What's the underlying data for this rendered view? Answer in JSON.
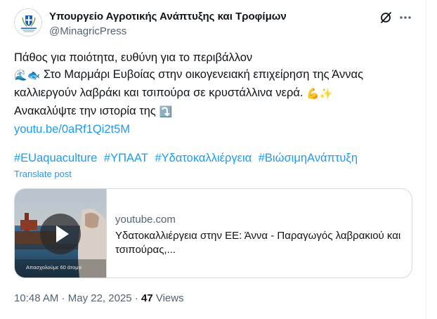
{
  "author": {
    "name": "Υπουργείο Αγροτικής Ανάπτυξης και Τροφίμων",
    "handle": "@MinagricPress",
    "avatar_icon": "greek-coat-of-arms-icon"
  },
  "header_actions": {
    "grok_icon": "grok-icon",
    "more_icon": "more-horizontal-icon"
  },
  "tweet": {
    "line1": "Πάθος για ποιότητα, ευθύνη για το περιβάλλον",
    "line2_emoji": "🌊🐟",
    "line2_text": " Στο Μαρμάρι Ευβοίας στην οικογενειακή επιχείρηση της Άννας",
    "line3_text": "καλλιεργούν λαβράκι και τσιπούρα σε κρυστάλλινα νερά. ",
    "line3_emoji": "💪✨",
    "line4_text": "Ανακαλύψτε την ιστορία της ",
    "line4_emoji": "⤵️",
    "link": "youtu.be/0aRf1Qi2t5M",
    "hashtags": [
      "#EUaquaculture",
      "#ΥΠΑΑΤ",
      "#Υδατοκαλλιέργεια",
      "#ΒιώσιμηΑνάπτυξη"
    ],
    "translate_label": "Translate post"
  },
  "link_card": {
    "domain": "youtube.com",
    "title": "Υδατοκαλλιέργεια στην ΕΕ: Άννα - Παραγωγός λαβρακιού και τσιπούρας,...",
    "thumb_caption": "Απασχολούμε 60 άτομα",
    "play_icon": "play-icon"
  },
  "meta": {
    "time": "10:48 AM",
    "separator": " · ",
    "date": "May 22, 2025",
    "views_count": "47",
    "views_label": " Views"
  },
  "colors": {
    "link": "#1d9bf0",
    "muted": "#536471",
    "text": "#0f1419",
    "border": "#cfd9de"
  }
}
